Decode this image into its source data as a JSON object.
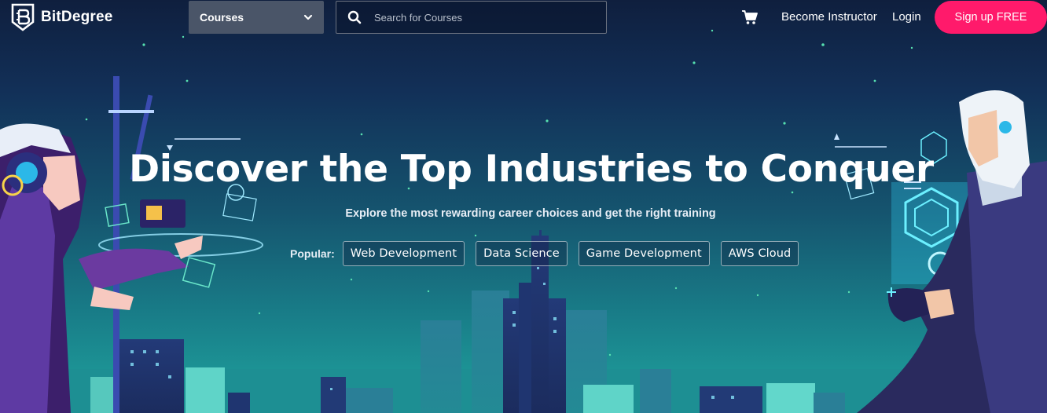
{
  "brand": {
    "name": "BitDegree",
    "accent": "#ff1a6b",
    "logo_icon": "bitdegree-shield-logo"
  },
  "header": {
    "courses_label": "Courses",
    "search_placeholder": "Search for Courses",
    "cart_icon": "cart-icon",
    "become_instructor": "Become Instructor",
    "login": "Login",
    "signup": "Sign up FREE"
  },
  "hero": {
    "title": "Discover the Top Industries to Conquer",
    "subtitle": "Explore the most rewarding career choices and get the right training",
    "popular_label": "Popular:",
    "popular_tags": [
      "Web Development",
      "Data Science",
      "Game Development",
      "AWS Cloud"
    ]
  }
}
